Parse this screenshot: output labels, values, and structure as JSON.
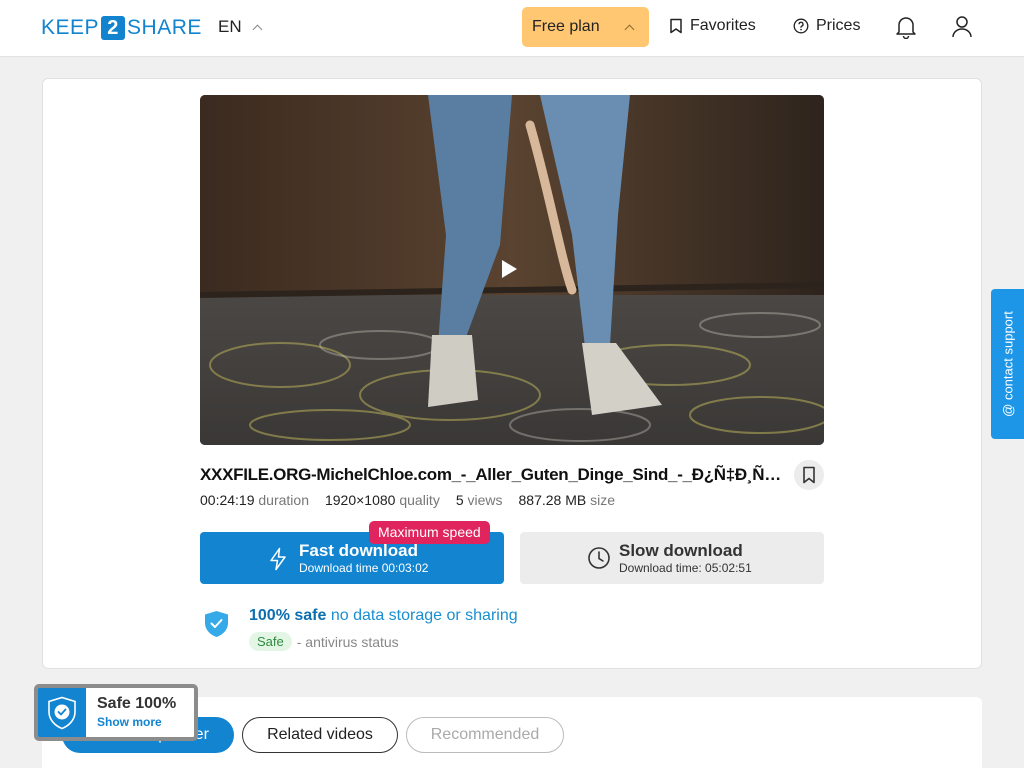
{
  "header": {
    "logo_left": "KEEP",
    "logo_mid": "2",
    "logo_right": "SHARE",
    "language": "EN",
    "plan_label": "Free plan",
    "favorites_label": "Favorites",
    "prices_label": "Prices",
    "accent_color": "#1283cf",
    "plan_color": "#ffc772"
  },
  "video": {
    "title": "XXXFILE.ORG-MichelChloe.com_-_Aller_Guten_Dinge_Sind_-_Ð¿Ñ‡Ð¸Ñ€Ð…",
    "duration_value": "00:24:19",
    "duration_label": "duration",
    "quality_value": "1920×1080",
    "quality_label": "quality",
    "views_value": "5",
    "views_label": "views",
    "size_value": "887.28 MB",
    "size_label": "size"
  },
  "download": {
    "fast_label": "Fast download",
    "fast_time": "Download time 00:03:02",
    "badge": "Maximum speed",
    "slow_label": "Slow download",
    "slow_time": "Download time: 05:02:51"
  },
  "safety": {
    "headline_bold": "100% safe",
    "headline_rest": " no data storage or sharing",
    "status_pill": "Safe",
    "status_text": "- antivirus status"
  },
  "tabs": [
    {
      "label": "From this partner"
    },
    {
      "label": "Related videos"
    },
    {
      "label": "Recommended"
    }
  ],
  "safe_widget": {
    "title": "Safe 100%",
    "link": "Show more"
  },
  "support": {
    "label": "@ contact support"
  }
}
